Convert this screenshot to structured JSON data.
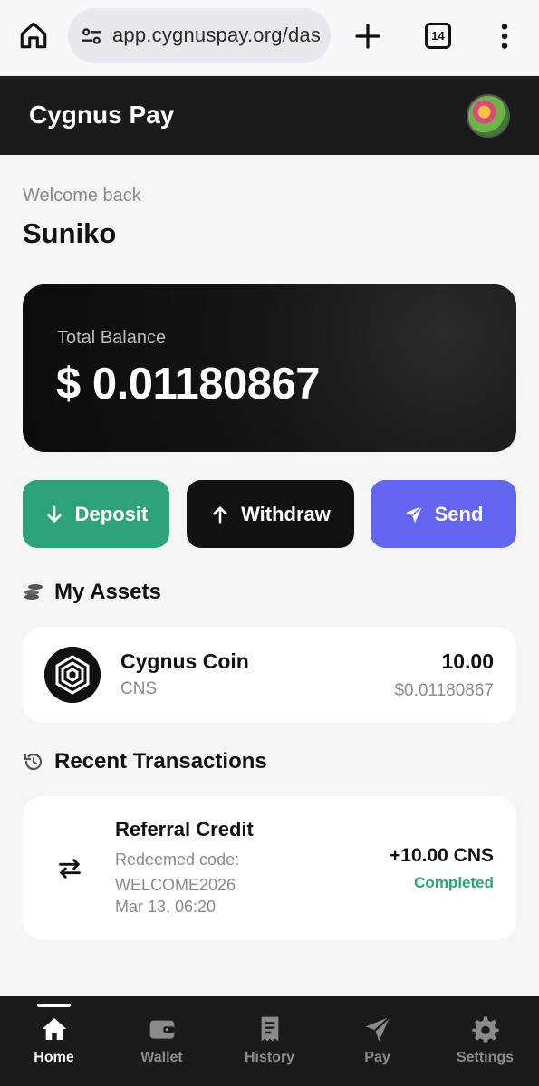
{
  "browser": {
    "url": "app.cygnuspay.org/das",
    "tab_count": "14",
    "icons": [
      "home-icon",
      "site-settings-icon",
      "plus-icon",
      "tabs-icon",
      "more-vert-icon"
    ]
  },
  "header": {
    "title": "Cygnus Pay"
  },
  "welcome": {
    "label": "Welcome back",
    "name": "Suniko"
  },
  "balance": {
    "label": "Total Balance",
    "value": "$ 0.01180867"
  },
  "actions": {
    "deposit": "Deposit",
    "withdraw": "Withdraw",
    "send": "Send"
  },
  "assets": {
    "heading": "My Assets",
    "items": [
      {
        "name": "Cygnus Coin",
        "symbol": "CNS",
        "amount": "10.00",
        "usd": "$0.01180867"
      }
    ]
  },
  "transactions": {
    "heading": "Recent Transactions",
    "items": [
      {
        "title": "Referral Credit",
        "description": "Redeemed code: WELCOME2026",
        "date": "Mar 13, 06:20",
        "amount": "+10.00 CNS",
        "status": "Completed"
      }
    ]
  },
  "nav": {
    "items": [
      {
        "label": "Home",
        "icon": "home-icon",
        "active": true
      },
      {
        "label": "Wallet",
        "icon": "wallet-icon",
        "active": false
      },
      {
        "label": "History",
        "icon": "receipt-icon",
        "active": false
      },
      {
        "label": "Pay",
        "icon": "paper-plane-icon",
        "active": false
      },
      {
        "label": "Settings",
        "icon": "gear-icon",
        "active": false
      }
    ]
  },
  "colors": {
    "deposit": "#2ea37a",
    "withdraw": "#111111",
    "send": "#6366f1",
    "status_completed": "#2ea37a",
    "header_bg": "#1b1b1b"
  }
}
